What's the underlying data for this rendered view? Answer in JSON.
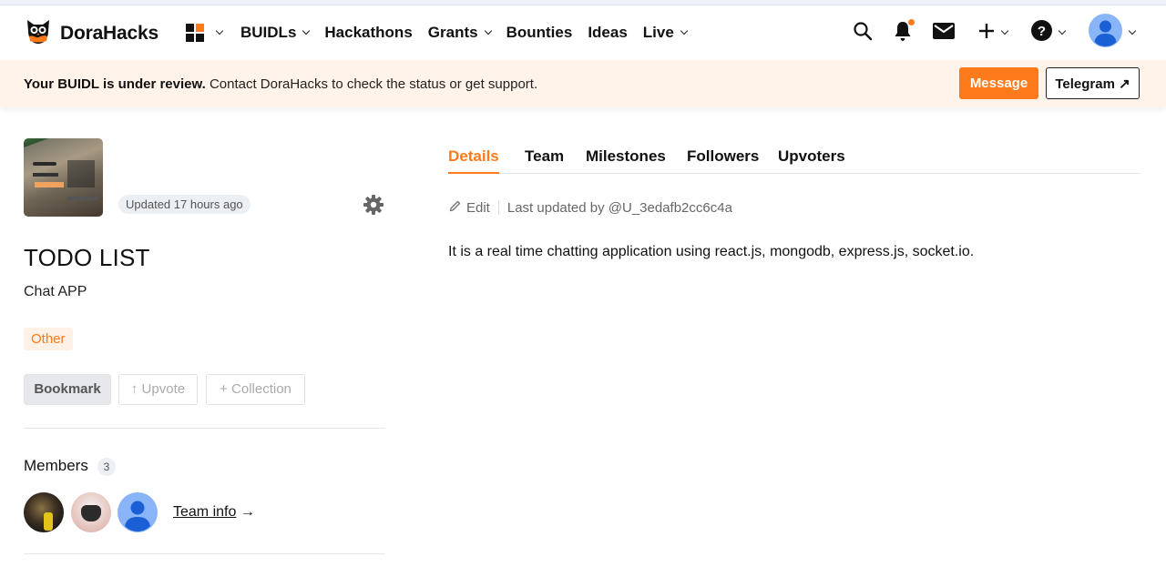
{
  "nav": {
    "brand": "DoraHacks",
    "items": [
      {
        "label": "BUIDLs",
        "has_dropdown": true
      },
      {
        "label": "Hackathons",
        "has_dropdown": false
      },
      {
        "label": "Grants",
        "has_dropdown": true
      },
      {
        "label": "Bounties",
        "has_dropdown": false
      },
      {
        "label": "Ideas",
        "has_dropdown": false
      },
      {
        "label": "Live",
        "has_dropdown": true
      }
    ],
    "icons": [
      "apps-grid-icon",
      "search-icon",
      "bell-icon",
      "mail-icon",
      "plus-icon",
      "help-icon",
      "avatar-icon"
    ],
    "accent": "#ff7a1a"
  },
  "banner": {
    "bold": "Your BUIDL is under review.",
    "text": " Contact DoraHacks to check the status or get support.",
    "message_button": "Message",
    "telegram_button": "Telegram ↗"
  },
  "project": {
    "updated": "Updated 17 hours ago",
    "title": "TODO LIST",
    "subtitle": "Chat APP",
    "tag": "Other",
    "actions": {
      "bookmark": "Bookmark",
      "upvote": "↑ Upvote",
      "collection": "+ Collection"
    },
    "members_label": "Members",
    "members_count": "3",
    "team_info": "Team info",
    "team_info_arrow": " →"
  },
  "tabs": [
    {
      "label": "Details",
      "active": true
    },
    {
      "label": "Team",
      "active": false
    },
    {
      "label": "Milestones",
      "active": false
    },
    {
      "label": "Followers",
      "active": false
    },
    {
      "label": "Upvoters",
      "active": false
    }
  ],
  "details": {
    "edit_label": "Edit",
    "last_updated": "Last updated by @U_3edafb2cc6c4a",
    "description": "It is a real time chatting application using react.js, mongodb, express.js, socket.io."
  }
}
